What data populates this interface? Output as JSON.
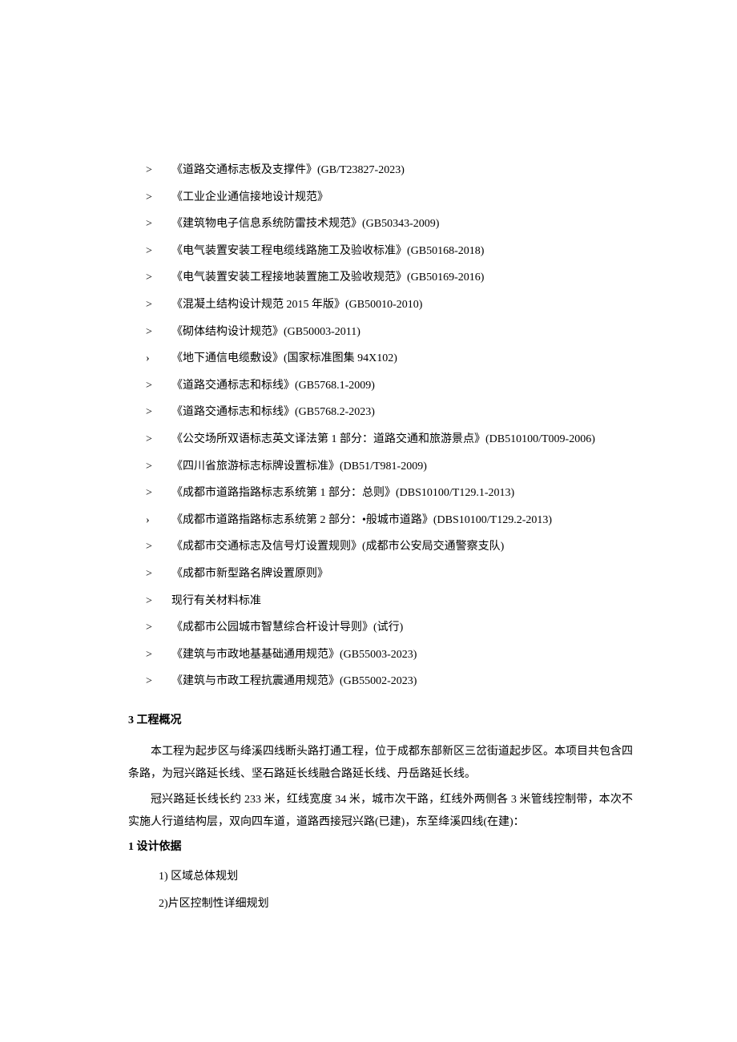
{
  "standards": [
    {
      "bullet": ">",
      "text": "《道路交通标志板及支撑件》(GB/T23827-2023)"
    },
    {
      "bullet": ">",
      "text": "《工业企业通信接地设计规范》"
    },
    {
      "bullet": ">",
      "text": "《建筑物电子信息系统防雷技术规范》(GB50343-2009)"
    },
    {
      "bullet": ">",
      "text": "《电气装置安装工程电缆线路施工及验收标准》(GB50168-2018)"
    },
    {
      "bullet": ">",
      "text": "《电气装置安装工程接地装置施工及验收规范》(GB50169-2016)"
    },
    {
      "bullet": ">",
      "text": "《混凝土结构设计规范 2015 年版》(GB50010-2010)"
    },
    {
      "bullet": ">",
      "text": "《砌体结构设计规范》(GB50003-2011)"
    },
    {
      "bullet": "›",
      "text": "《地下通信电缆敷设》(国家标准图集 94X102)"
    },
    {
      "bullet": ">",
      "text": "《道路交通标志和标线》(GB5768.1-2009)"
    },
    {
      "bullet": ">",
      "text": "《道路交通标志和标线》(GB5768.2-2023)"
    },
    {
      "bullet": ">",
      "text": "《公交场所双语标志英文译法第 1 部分：道路交通和旅游景点》(DB510100/T009-2006)"
    },
    {
      "bullet": ">",
      "text": "《四川省旅游标志标牌设置标准》(DB51/T981-2009)"
    },
    {
      "bullet": ">",
      "text": "《成都市道路指路标志系统第 1 部分：总则》(DBS10100/T129.1-2013)"
    },
    {
      "bullet": "›",
      "text": "《成都市道路指路标志系统第 2 部分：•般城市道路》(DBS10100/T129.2-2013)"
    },
    {
      "bullet": ">",
      "text": "《成都市交通标志及信号灯设置规则》(成都市公安局交通警察支队)"
    },
    {
      "bullet": ">",
      "text": "《成都市新型路名牌设置原则》"
    },
    {
      "bullet": ">",
      "text": "现行有关材料标准"
    },
    {
      "bullet": ">",
      "text": "《成都市公园城市智慧综合杆设计导则》(试行)"
    },
    {
      "bullet": ">",
      "text": "《建筑与市政地基基础通用规范》(GB55003-2023)"
    },
    {
      "bullet": ">",
      "text": "《建筑与市政工程抗震通用规范》(GB55002-2023)"
    }
  ],
  "section3": {
    "heading": "3 工程概况",
    "para1": "本工程为起步区与绛溪四线断头路打通工程，位于成都东部新区三岔街道起步区。本项目共包含四条路，为冠兴路延长线、坚石路延长线融合路延长线、丹岳路延长线。",
    "para2": "冠兴路延长线长约 233 米，红线宽度 34 米，城市次干路，红线外两侧各 3 米管线控制带，本次不实施人行道结构层，双向四车道，道路西接冠兴路(已建)，东至绛溪四线(在建)："
  },
  "section1": {
    "heading": "1 设计依据",
    "items": [
      "1) 区域总体规划",
      "2)片区控制性详细规划"
    ]
  }
}
